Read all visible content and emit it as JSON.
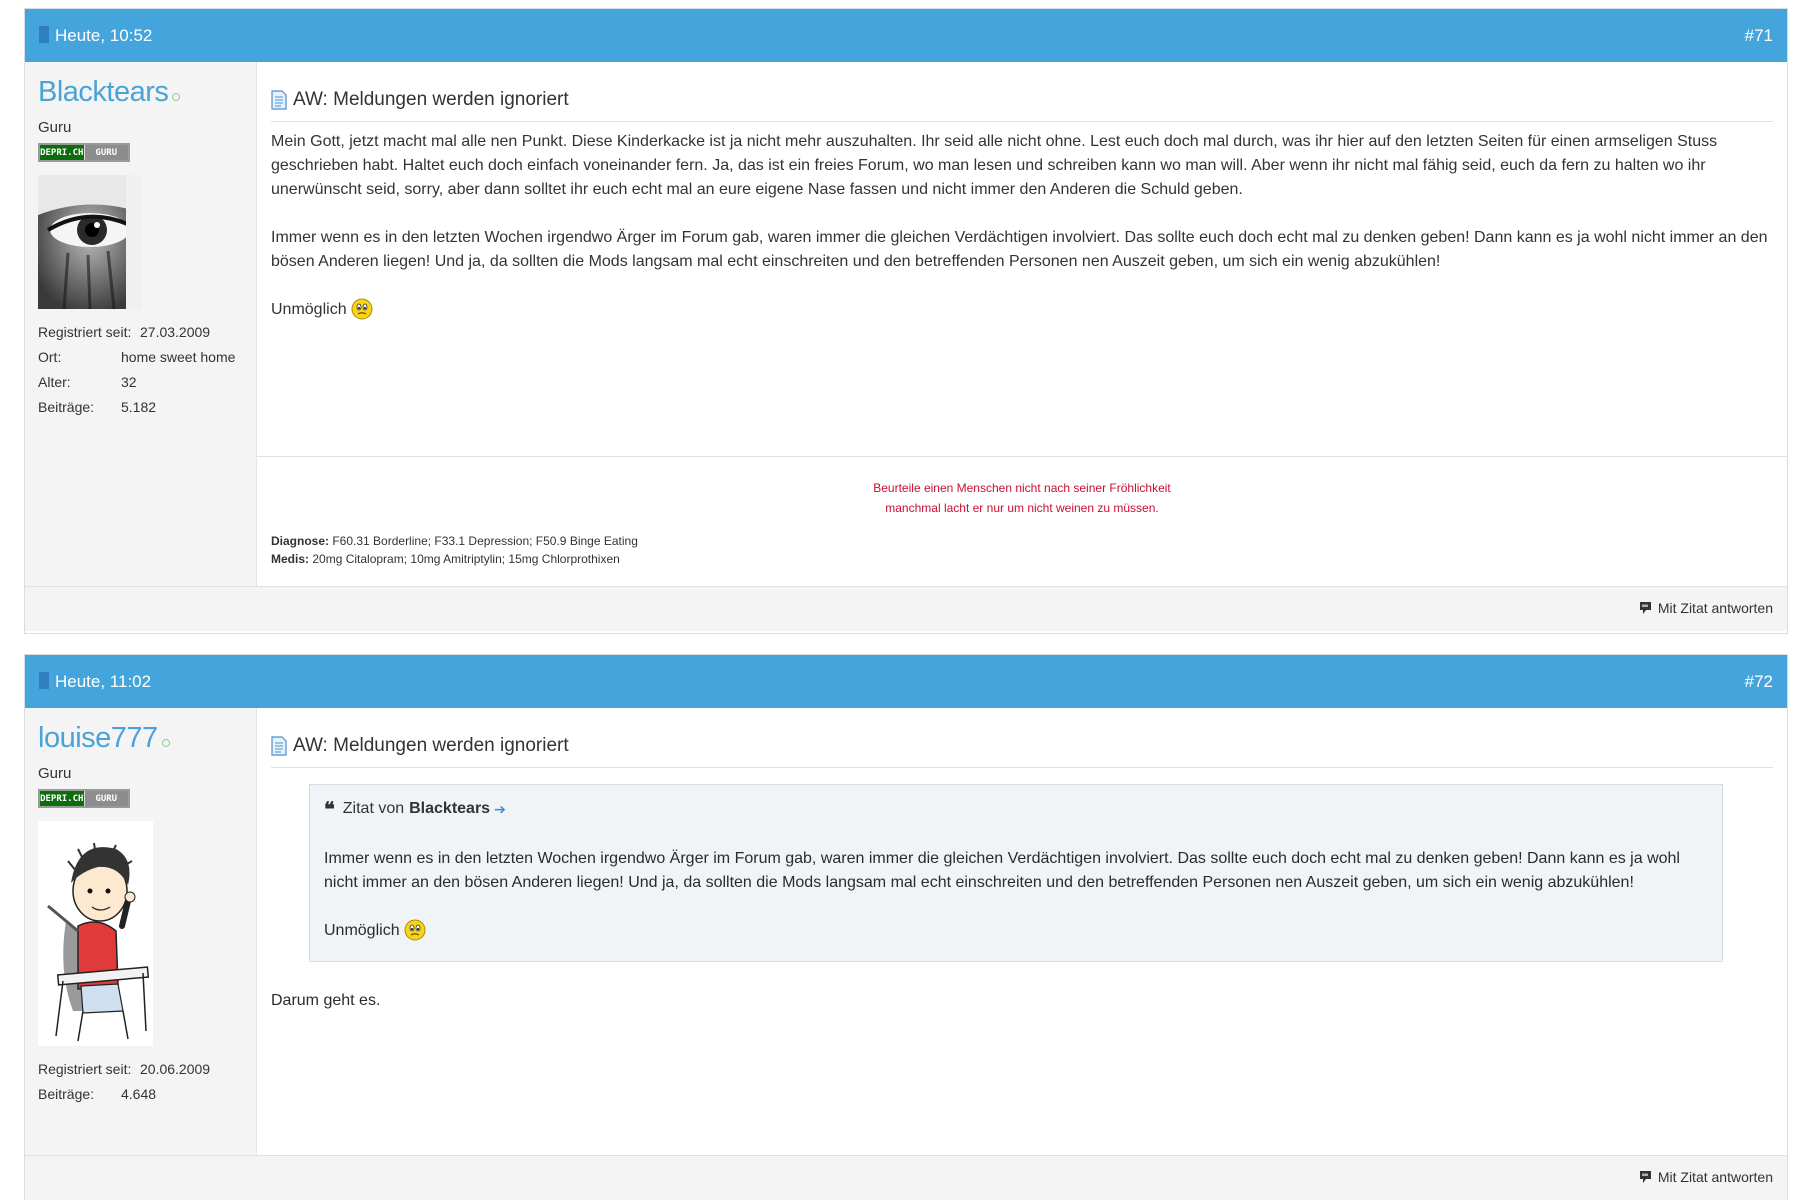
{
  "posts": [
    {
      "date": "Heute, 10:52",
      "number": "#71",
      "username": "Blacktears",
      "rank": "Guru",
      "badge": [
        "DEPRI.CH",
        "GURU"
      ],
      "stats": [
        {
          "key": "Registriert seit:",
          "value": "27.03.2009"
        },
        {
          "key": "Ort:",
          "value": "home sweet home"
        },
        {
          "key": "Alter:",
          "value": "32"
        },
        {
          "key": "Beiträge:",
          "value": "5.182"
        }
      ],
      "title": "AW: Meldungen werden ignoriert",
      "paragraphs": [
        "Mein Gott, jetzt macht mal alle nen Punkt. Diese Kinderkacke ist ja nicht mehr auszuhalten. Ihr seid alle nicht ohne. Lest euch doch mal durch, was ihr hier auf den letzten Seiten für einen armseligen Stuss geschrieben habt. Haltet euch doch einfach voneinander fern. Ja, das ist ein freies Forum, wo man lesen und schreiben kann wo man will. Aber wenn ihr nicht mal fähig seid, euch da fern zu halten wo ihr unerwünscht seid, sorry, aber dann solltet ihr euch echt mal an eure eigene Nase fassen und nicht immer den Anderen die Schuld geben.",
        "Immer wenn es in den letzten Wochen irgendwo Ärger im Forum gab, waren immer die gleichen Verdächtigen involviert. Das sollte euch doch echt mal zu denken geben! Dann kann es ja wohl nicht immer an den bösen Anderen liegen! Und ja, da sollten die Mods langsam mal echt einschreiten und den betreffenden Personen nen Auszeit geben, um sich ein wenig abzukühlen!",
        "Unmöglich"
      ],
      "signature": {
        "quote_line1": "Beurteile einen Menschen nicht nach seiner Fröhlichkeit",
        "quote_line2": "manchmal lacht er nur um nicht weinen zu müssen.",
        "diagnose_label": "Diagnose:",
        "diagnose_value": " F60.31 Borderline; F33.1 Depression; F50.9 Binge Eating",
        "medis_label": "Medis:",
        "medis_value": " 20mg Citalopram; 10mg Amitriptylin; 15mg Chlorprothixen"
      },
      "reply_label": "Mit Zitat antworten"
    },
    {
      "date": "Heute, 11:02",
      "number": "#72",
      "username": "louise777",
      "rank": "Guru",
      "badge": [
        "DEPRI.CH",
        "GURU"
      ],
      "stats": [
        {
          "key": "Registriert seit:",
          "value": "20.06.2009"
        },
        {
          "key": "Beiträge:",
          "value": "4.648"
        }
      ],
      "title": "AW: Meldungen werden ignoriert",
      "quote": {
        "prefix": "Zitat von",
        "author": "Blacktears",
        "paragraphs": [
          "Immer wenn es in den letzten Wochen irgendwo Ärger im Forum gab, waren immer die gleichen Verdächtigen involviert. Das sollte euch doch echt mal zu denken geben! Dann kann es ja wohl nicht immer an den bösen Anderen liegen! Und ja, da sollten die Mods langsam mal echt einschreiten und den betreffenden Personen nen Auszeit geben, um sich ein wenig abzukühlen!",
          "Unmöglich"
        ]
      },
      "reply_text": "Darum geht es.",
      "reply_label": "Mit Zitat antworten"
    }
  ],
  "colors": {
    "header": "#44a4dc",
    "username": "#4aa3d6",
    "signature": "#c8102e"
  },
  "icons": [
    "document-icon",
    "smiley-icon",
    "quote-reply-icon",
    "online-status-icon",
    "go-to-post-arrow-icon"
  ]
}
